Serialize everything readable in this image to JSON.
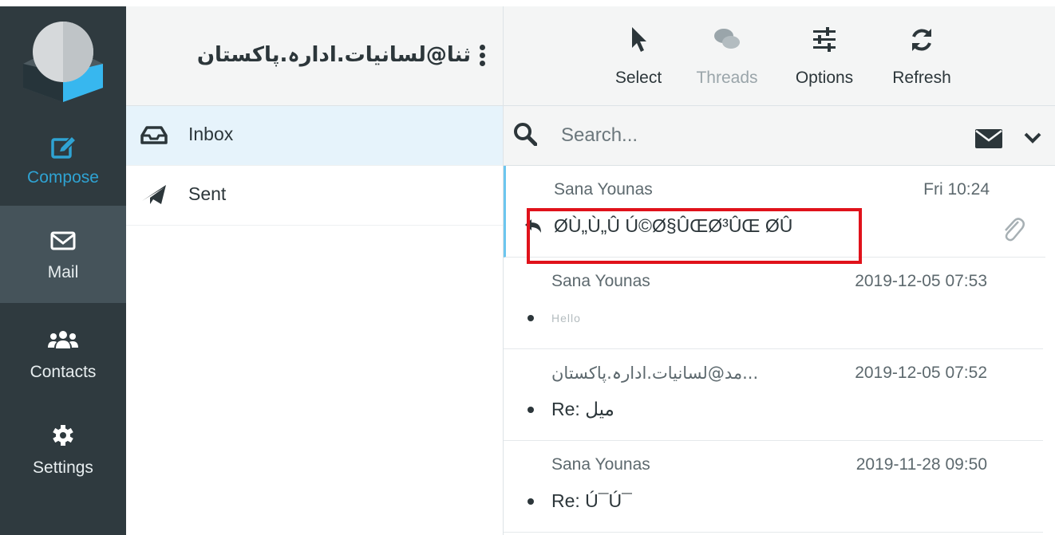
{
  "account": {
    "name": "ثنا@لسانیات.ادارہ.پاکستان"
  },
  "taskbar": {
    "items": [
      {
        "label": "Compose",
        "icon": "compose-icon"
      },
      {
        "label": "Mail",
        "icon": "envelope-icon"
      },
      {
        "label": "Contacts",
        "icon": "users-icon"
      },
      {
        "label": "Settings",
        "icon": "gear-icon"
      }
    ]
  },
  "folders": [
    {
      "label": "Inbox",
      "icon": "inbox-icon"
    },
    {
      "label": "Sent",
      "icon": "paper-plane-icon"
    }
  ],
  "toolbar": {
    "select_label": "Select",
    "threads_label": "Threads",
    "options_label": "Options",
    "refresh_label": "Refresh"
  },
  "search": {
    "placeholder": "Search..."
  },
  "messages": [
    {
      "sender": "Sana Younas",
      "date": "Fri 10:24",
      "subject": "ØÙ„Ù„Û Ú©Ø§ÛŒØ³ÛŒ ØÛ"
    },
    {
      "sender": "Sana Younas",
      "date": "2019-12-05 07:53",
      "subject": "Hello"
    },
    {
      "sender": "...مد@لسانیات.ادارہ.پاکستان",
      "date": "2019-12-05 07:52",
      "subject": "Re: میل"
    },
    {
      "sender": "Sana Younas",
      "date": "2019-11-28 09:50",
      "subject": "Re: Ú¯Ú¯"
    }
  ],
  "colors": {
    "taskbar_bg": "#2f3a3f",
    "taskbar_active": "#45535a",
    "accent": "#2fa3d3",
    "highlight_box": "#e0121b"
  }
}
